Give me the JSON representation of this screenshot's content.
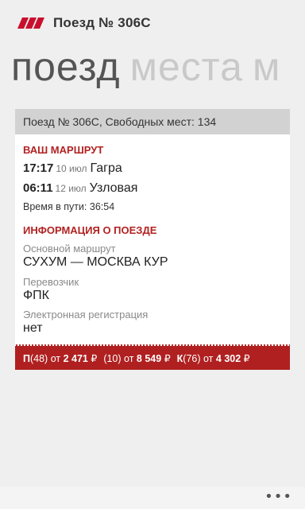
{
  "header": {
    "title": "Поезд № 306С",
    "logo_icon": "rzd-logo-icon",
    "brand_color": "#c8102e"
  },
  "pivot": {
    "items": [
      {
        "label": "поезд"
      },
      {
        "label": "места"
      },
      {
        "label": "м"
      }
    ]
  },
  "card": {
    "header": "Поезд № 306С, Свободных мест: 134",
    "route": {
      "title": "ВАШ МАРШРУТ",
      "departure": {
        "time": "17:17",
        "date": "10 июл",
        "city": "Гагра"
      },
      "arrival": {
        "time": "06:11",
        "date": "12 июл",
        "city": "Узловая"
      },
      "travel_time": "Время в пути: 36:54"
    },
    "info": {
      "title": "ИНФОРМАЦИЯ О ПОЕЗДЕ",
      "main_route_label": "Основной маршрут",
      "main_route_value": "СУХУМ — МОСКВА КУР",
      "carrier_label": "Перевозчик",
      "carrier_value": "ФПК",
      "ereg_label": "Электронная регистрация",
      "ereg_value": "нет"
    },
    "prices": [
      {
        "code": "П",
        "count": "(48)",
        "from": "от",
        "price": "2 471",
        "currency": "₽"
      },
      {
        "code": "",
        "count": "(10)",
        "from": "от",
        "price": "8 549",
        "currency": "₽"
      },
      {
        "code": "К",
        "count": "(76)",
        "from": "от",
        "price": "4 302",
        "currency": "₽"
      }
    ]
  },
  "appbar": {
    "more_label": "•••"
  }
}
